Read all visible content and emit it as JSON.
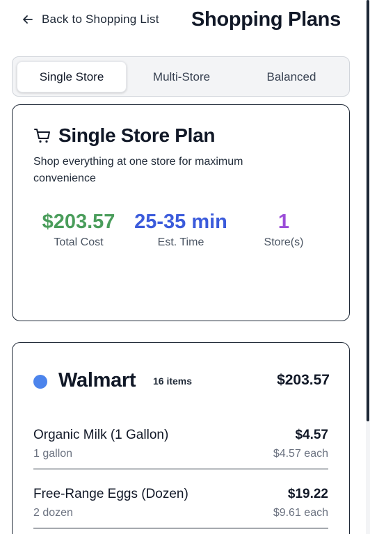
{
  "header": {
    "back_label": "Back to Shopping List",
    "back_icon": "arrow-left-icon",
    "title": "Shopping Plans"
  },
  "tabs": [
    {
      "label": "Single Store",
      "active": true
    },
    {
      "label": "Multi-Store",
      "active": false
    },
    {
      "label": "Balanced",
      "active": false
    }
  ],
  "plan": {
    "icon": "cart-icon",
    "title": "Single Store Plan",
    "description": "Shop everything at one store for maximum convenience",
    "stats": {
      "cost": {
        "value": "$203.57",
        "caption": "Total Cost",
        "color": "#4a9d5b"
      },
      "time": {
        "value": "25-35 min",
        "caption": "Est. Time",
        "color": "#3b5bdb"
      },
      "stores": {
        "value": "1",
        "caption": "Store(s)",
        "color": "#9b4dd8"
      }
    }
  },
  "store": {
    "name": "Walmart",
    "dot_color": "#4c84ec",
    "item_count": "16 items",
    "total": "$203.57",
    "items": [
      {
        "name": "Organic Milk (1 Gallon)",
        "qty": "1 gallon",
        "price": "$4.57",
        "unit_price": "$4.57 each"
      },
      {
        "name": "Free-Range Eggs (Dozen)",
        "qty": "2 dozen",
        "price": "$19.22",
        "unit_price": "$9.61 each"
      }
    ]
  },
  "colors": {
    "accent_green": "#4a9d5b",
    "accent_blue": "#3b5bdb",
    "accent_purple": "#9b4dd8",
    "store_dot": "#4c84ec"
  }
}
